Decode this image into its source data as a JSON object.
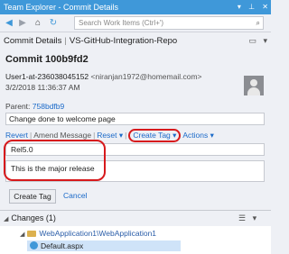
{
  "window": {
    "title": "Team Explorer - Commit Details"
  },
  "toolbar": {
    "search_placeholder": "Search Work Items (Ctrl+')"
  },
  "header": {
    "section": "Commit Details",
    "repo": "VS-GitHub-Integration-Repo"
  },
  "commit": {
    "title": "Commit 100b9fd2",
    "author": "User1-at-236038045152",
    "email": "<niranjan1972@homemail.com>",
    "date": "3/2/2018 11:36:37 AM",
    "parent_label": "Parent:",
    "parent_id": "758bdfb9",
    "message": "Change done to welcome page"
  },
  "actions": {
    "revert": "Revert",
    "amend": "Amend Message",
    "reset": "Reset",
    "create_tag": "Create Tag",
    "actions": "Actions"
  },
  "tag_form": {
    "name": "Rel5.0",
    "message": "This is the major release",
    "create_button": "Create Tag",
    "cancel_link": "Cancel"
  },
  "changes": {
    "header": "Changes (1)",
    "folder": "WebApplication1\\WebApplication1",
    "file": "Default.aspx"
  },
  "colors": {
    "accent": "#3f98d9",
    "link": "#1b6ac9",
    "annotation": "#d7191c"
  }
}
